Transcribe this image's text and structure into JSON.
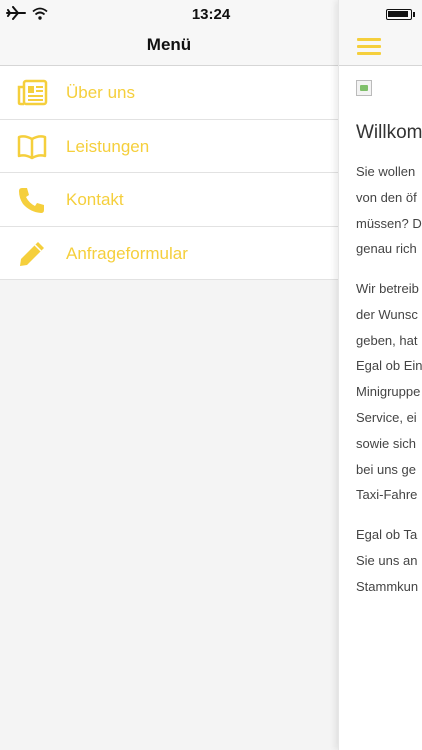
{
  "status": {
    "time": "13:24"
  },
  "menu": {
    "title": "Menü",
    "items": [
      {
        "label": "Über uns",
        "icon": "newspaper-icon"
      },
      {
        "label": "Leistungen",
        "icon": "book-icon"
      },
      {
        "label": "Kontakt",
        "icon": "phone-icon"
      },
      {
        "label": "Anfrageformular",
        "icon": "pencil-icon"
      }
    ]
  },
  "content": {
    "heading": "Willkom",
    "paragraphs": [
      "Sie wollen\nvon den öf\nmüssen? D\ngenau rich",
      "Wir betreib\nder Wunsc\ngeben, hat\nEgal ob Ein\nMinigruppe\nService, ei\nsowie sich\nbei uns ge\nTaxi-Fahre",
      "Egal ob Ta\nSie uns an\nStammkun"
    ]
  },
  "colors": {
    "accent": "#f5cf3c"
  }
}
